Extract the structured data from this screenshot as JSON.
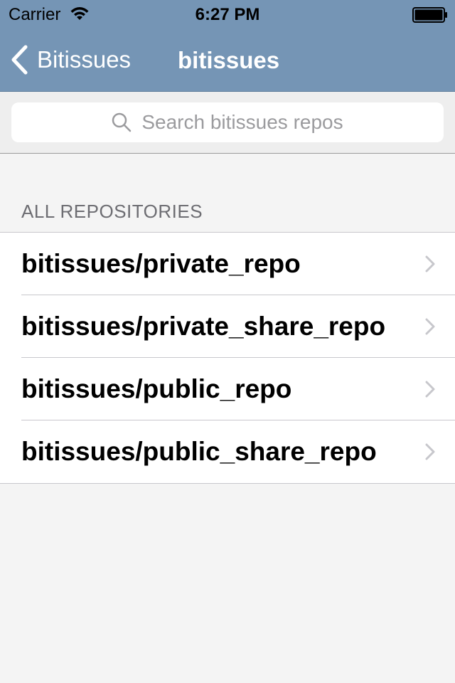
{
  "status_bar": {
    "carrier": "Carrier",
    "time": "6:27 PM"
  },
  "nav": {
    "back_label": "Bitissues",
    "title": "bitissues"
  },
  "search": {
    "placeholder": "Search bitissues repos"
  },
  "section": {
    "header": "ALL REPOSITORIES"
  },
  "repositories": [
    {
      "name": "bitissues/private_repo"
    },
    {
      "name": "bitissues/private_share_repo"
    },
    {
      "name": "bitissues/public_repo"
    },
    {
      "name": "bitissues/public_share_repo"
    }
  ],
  "colors": {
    "nav_background": "#7595b5",
    "page_background": "#f4f4f4",
    "chevron": "#c7c7cc"
  },
  "icons": {
    "wifi": "wifi-icon",
    "battery": "battery-icon",
    "back": "chevron-left-icon",
    "search": "search-icon",
    "disclosure": "chevron-right-icon"
  }
}
